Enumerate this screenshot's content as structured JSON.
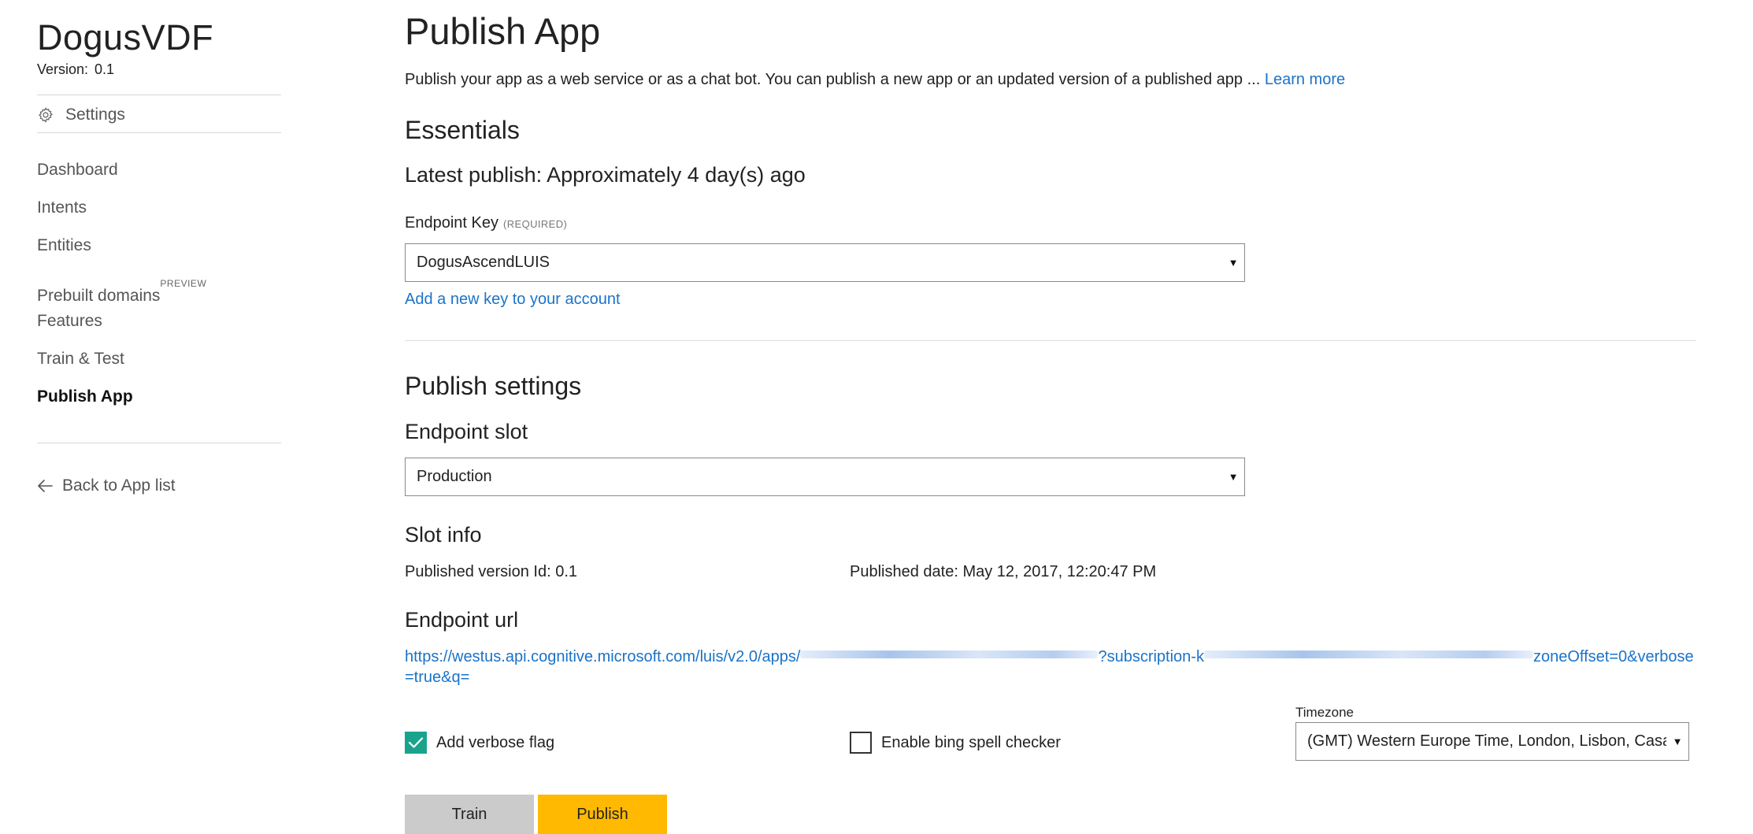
{
  "sidebar": {
    "app_name": "DogusVDF",
    "version_label": "Version:",
    "version_value": "0.1",
    "settings_label": "Settings",
    "settings_icon": "gear-icon",
    "items": [
      {
        "label": "Dashboard",
        "badge": "",
        "active": false
      },
      {
        "label": "Intents",
        "badge": "",
        "active": false
      },
      {
        "label": "Entities",
        "badge": "",
        "active": false
      },
      {
        "label": "Prebuilt domains",
        "badge": "PREVIEW",
        "active": false
      },
      {
        "label": "Features",
        "badge": "",
        "active": false
      },
      {
        "label": "Train & Test",
        "badge": "",
        "active": false
      },
      {
        "label": "Publish App",
        "badge": "",
        "active": true
      }
    ],
    "back_label": "Back to App list",
    "back_icon": "arrow-left-icon"
  },
  "main": {
    "title": "Publish App",
    "description": "Publish your app as a web service or as a chat bot. You can publish a new app or an updated version of a published app ...",
    "learn_more": "Learn more",
    "essentials": {
      "heading": "Essentials",
      "latest_publish": "Latest publish: Approximately 4 day(s) ago",
      "endpoint_key_label": "Endpoint Key",
      "endpoint_key_required": "(REQUIRED)",
      "endpoint_key_value": "DogusAscendLUIS",
      "add_key_link": "Add a new key to your account"
    },
    "publish_settings": {
      "heading": "Publish settings",
      "endpoint_slot_label": "Endpoint slot",
      "endpoint_slot_value": "Production",
      "slot_info_heading": "Slot info",
      "published_version": "Published version Id: 0.1",
      "published_date": "Published date: May 12, 2017, 12:20:47 PM",
      "endpoint_url_heading": "Endpoint url",
      "endpoint_url_part1": "https://westus.api.cognitive.microsoft.com/luis/v2.0/apps/",
      "endpoint_url_part2": "?subscription-k",
      "endpoint_url_part3": "zoneOffset=0&verbose=true&q=",
      "verbose_flag_label": "Add verbose flag",
      "verbose_flag_checked": true,
      "bing_spell_label": "Enable bing spell checker",
      "bing_spell_checked": false,
      "timezone_label": "Timezone",
      "timezone_value": "(GMT) Western Europe Time, London, Lisbon, Casablanca"
    },
    "buttons": {
      "train": "Train",
      "publish": "Publish"
    }
  },
  "colors": {
    "link": "#1a73c8",
    "checkbox_checked": "#1aa38c",
    "publish_button": "#ffb900",
    "train_button": "#cbcbcb"
  }
}
